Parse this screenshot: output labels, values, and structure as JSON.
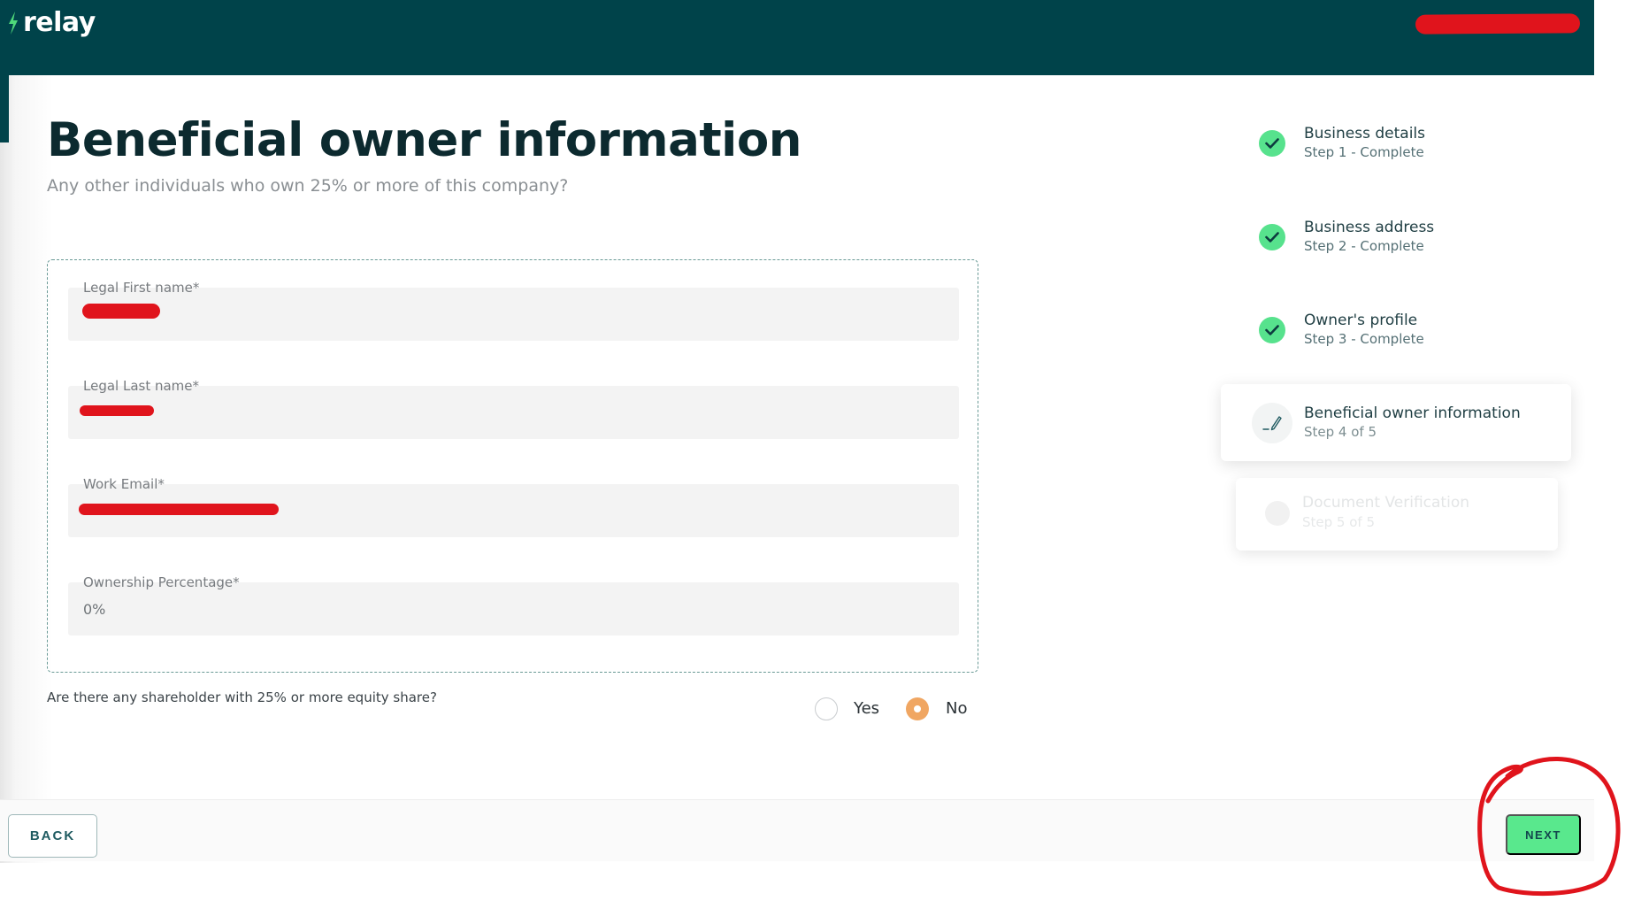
{
  "app": {
    "logo_text": "relay"
  },
  "page": {
    "title": "Beneficial owner information",
    "subtitle": "Any other individuals who own 25% or more of this company?"
  },
  "form": {
    "first_name_label": "Legal First name*",
    "last_name_label": "Legal Last name*",
    "email_label": "Work Email*",
    "ownership_label": "Ownership Percentage*",
    "ownership_value": "0%"
  },
  "question": {
    "text": "Are there any shareholder with 25% or more equity share?",
    "options": [
      {
        "label": "Yes",
        "selected": false
      },
      {
        "label": "No",
        "selected": true
      }
    ]
  },
  "steps": [
    {
      "title": "Business details",
      "sub": "Step 1 - Complete",
      "status": "complete"
    },
    {
      "title": "Business address",
      "sub": "Step 2 - Complete",
      "status": "complete"
    },
    {
      "title": "Owner's profile",
      "sub": "Step 3 - Complete",
      "status": "complete"
    },
    {
      "title": "Beneficial owner information",
      "sub": "Step 4 of 5",
      "status": "current"
    },
    {
      "title": "Document Verification",
      "sub": "Step 5 of 5",
      "status": "upcoming"
    }
  ],
  "footer": {
    "back_label": "BACK",
    "next_label": "NEXT"
  },
  "colors": {
    "header": "#00434a",
    "accent": "#59e88d",
    "radio_selected": "#f0a662",
    "annotation": "#e0141c"
  },
  "icons": {
    "complete": "check-icon",
    "current": "pencil-icon",
    "logo": "bolt-icon"
  }
}
